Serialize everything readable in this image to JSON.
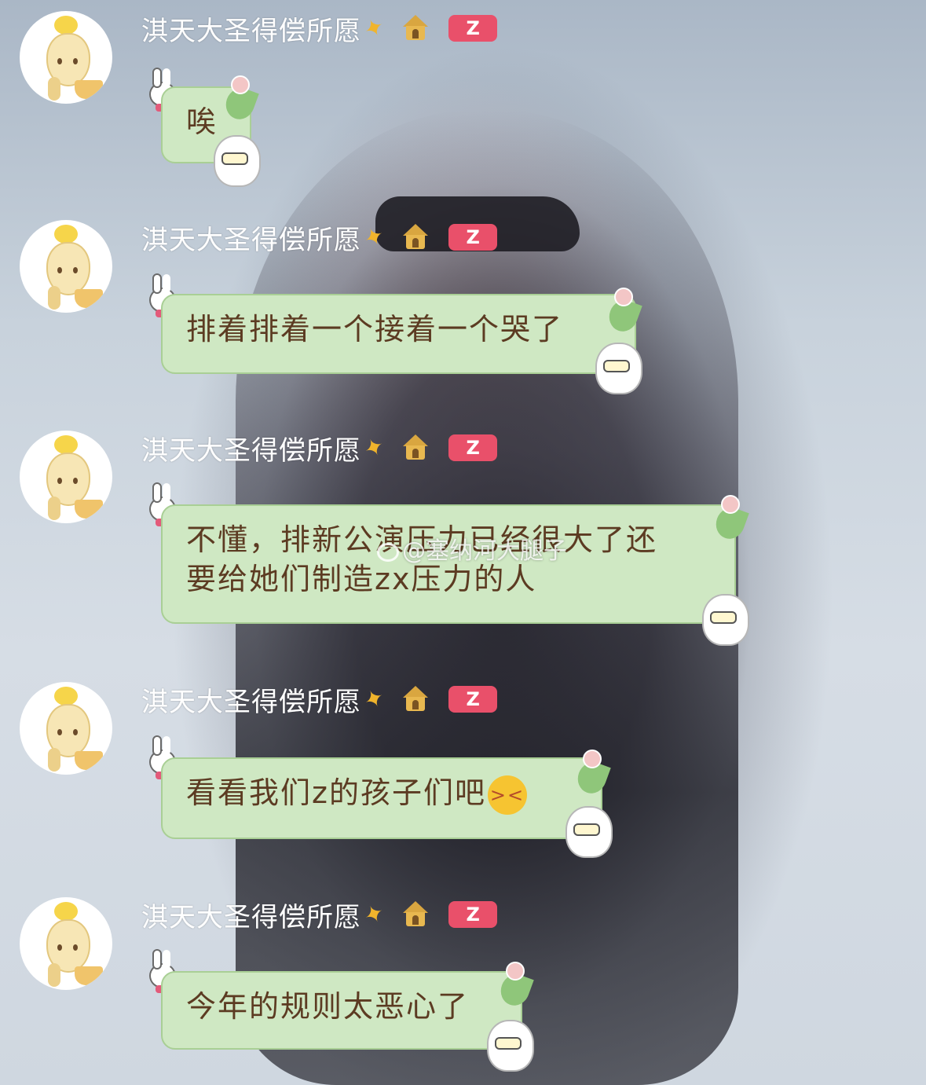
{
  "watermark": "@塞纳河大腿子",
  "messages": [
    {
      "sender": "淇天大圣得偿所愿",
      "badge": "Z",
      "lines": [
        "唉"
      ],
      "sparkle_icon": "sparkle-icon",
      "home_icon": "home-icon"
    },
    {
      "sender": "淇天大圣得偿所愿",
      "badge": "Z",
      "lines": [
        "排着排着一个接着一个哭了"
      ]
    },
    {
      "sender": "淇天大圣得偿所愿",
      "badge": "Z",
      "lines": [
        "不懂，排新公演压力已经很大了还",
        "要给她们制造zx压力的人"
      ]
    },
    {
      "sender": "淇天大圣得偿所愿",
      "badge": "Z",
      "lines": [
        "看看我们z的孩子们吧"
      ],
      "emoji": "crying-angry-face"
    },
    {
      "sender": "淇天大圣得偿所愿",
      "badge": "Z",
      "lines": [
        "今年的规则太恶心了"
      ]
    }
  ],
  "colors": {
    "bubble_fill": "#cfe8c3",
    "bubble_border": "#a9cf95",
    "bubble_text": "#5c3b22",
    "badge": "#e9506a",
    "name_text": "#ffffff"
  }
}
